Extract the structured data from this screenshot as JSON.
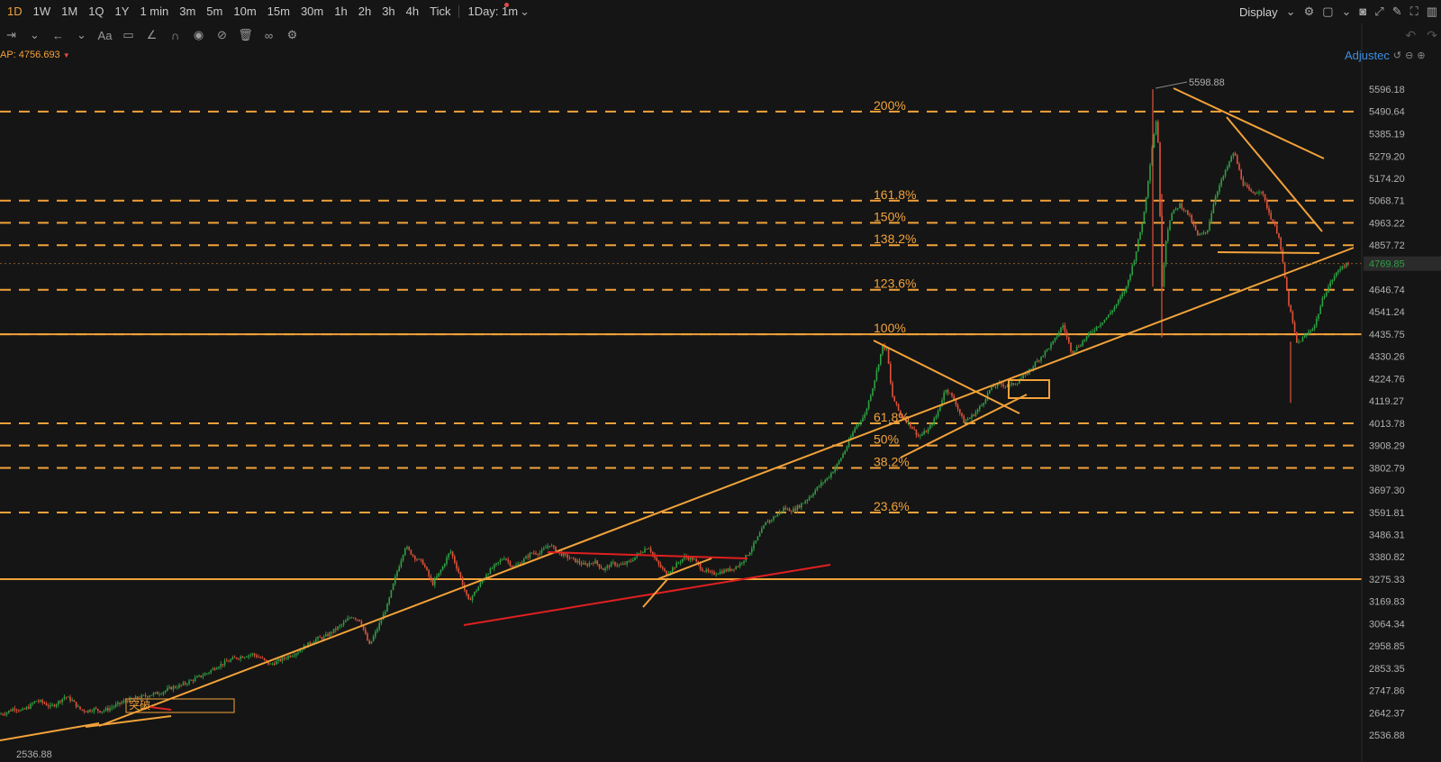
{
  "toolbar": {
    "timeframes": [
      "1D",
      "1W",
      "1M",
      "1Q",
      "1Y",
      "1 min",
      "3m",
      "5m",
      "10m",
      "15m",
      "30m",
      "1h",
      "2h",
      "3h",
      "4h",
      "Tick"
    ],
    "active": "1D",
    "interval_select": "1Day: 1m",
    "display_label": "Display"
  },
  "indicator": {
    "label": "AP:",
    "value": "4756.693"
  },
  "adjust_label": "Adjustec",
  "icons": {
    "toolbar_right": [
      "chevron-down-icon",
      "settings-icon",
      "layout-icon",
      "chevron-down-icon",
      "camera-icon",
      "expand-icon",
      "pencil-icon",
      "fullscreen-icon",
      "panel-icon"
    ],
    "tools": [
      "ruler-icon",
      "arrow-left-icon",
      "text-icon",
      "comment-icon",
      "draw-icon",
      "magnet-icon",
      "eye-icon",
      "hide-icon",
      "trash-icon",
      "link-icon",
      "gear-icon"
    ]
  },
  "colors": {
    "background": "#151515",
    "fib": "#f2a23a",
    "up": "#2ea043",
    "down": "#e0533a",
    "red_line": "#e02020",
    "price_badge": "#2b2b2b"
  },
  "chart_data": {
    "type": "candlestick",
    "y_axis_ticks": [
      5596.18,
      5490.64,
      5385.19,
      5279.2,
      5174.2,
      5068.71,
      4963.22,
      4857.72,
      4646.74,
      4541.24,
      4435.75,
      4330.26,
      4224.76,
      4119.27,
      4013.78,
      3908.29,
      3802.79,
      3697.3,
      3591.81,
      3486.31,
      3380.82,
      3275.33,
      3169.83,
      3064.34,
      2958.85,
      2853.35,
      2747.86,
      2642.37,
      2536.88
    ],
    "current_price": "4769.85",
    "high_label": "5598.88",
    "low_label": "2536.88",
    "ylim": [
      2536.88,
      5596.18
    ],
    "fib_levels": [
      {
        "label": "200%",
        "price": 5490
      },
      {
        "label": "161.8%",
        "price": 5068
      },
      {
        "label": "150%",
        "price": 4963
      },
      {
        "label": "138.2%",
        "price": 4857
      },
      {
        "label": "123.6%",
        "price": 4646
      },
      {
        "label": "100%",
        "price": 4435
      },
      {
        "label": "61.8%",
        "price": 4013
      },
      {
        "label": "50%",
        "price": 3908
      },
      {
        "label": "38.2%",
        "price": 3802
      },
      {
        "label": "23.6%",
        "price": 3591
      }
    ],
    "horizontal_lines": [
      4435,
      3275
    ],
    "annotation_text": "突破",
    "price_path": [
      [
        0,
        2635
      ],
      [
        8,
        2645
      ],
      [
        16,
        2665
      ],
      [
        24,
        2650
      ],
      [
        32,
        2670
      ],
      [
        40,
        2700
      ],
      [
        48,
        2690
      ],
      [
        56,
        2670
      ],
      [
        64,
        2690
      ],
      [
        72,
        2720
      ],
      [
        80,
        2700
      ],
      [
        88,
        2660
      ],
      [
        96,
        2650
      ],
      [
        104,
        2660
      ],
      [
        112,
        2650
      ],
      [
        120,
        2660
      ],
      [
        130,
        2680
      ],
      [
        140,
        2700
      ],
      [
        150,
        2710
      ],
      [
        160,
        2720
      ],
      [
        170,
        2730
      ],
      [
        180,
        2740
      ],
      [
        190,
        2760
      ],
      [
        200,
        2770
      ],
      [
        210,
        2790
      ],
      [
        220,
        2810
      ],
      [
        230,
        2830
      ],
      [
        240,
        2860
      ],
      [
        250,
        2880
      ],
      [
        260,
        2900
      ],
      [
        270,
        2910
      ],
      [
        280,
        2920
      ],
      [
        290,
        2900
      ],
      [
        300,
        2870
      ],
      [
        310,
        2890
      ],
      [
        320,
        2910
      ],
      [
        330,
        2930
      ],
      [
        340,
        2960
      ],
      [
        350,
        2990
      ],
      [
        360,
        3000
      ],
      [
        370,
        3030
      ],
      [
        380,
        3060
      ],
      [
        390,
        3100
      ],
      [
        400,
        3080
      ],
      [
        410,
        2960
      ],
      [
        420,
        3050
      ],
      [
        430,
        3150
      ],
      [
        440,
        3300
      ],
      [
        450,
        3430
      ],
      [
        460,
        3380
      ],
      [
        470,
        3350
      ],
      [
        480,
        3250
      ],
      [
        490,
        3320
      ],
      [
        500,
        3410
      ],
      [
        510,
        3300
      ],
      [
        520,
        3170
      ],
      [
        530,
        3230
      ],
      [
        540,
        3300
      ],
      [
        550,
        3340
      ],
      [
        560,
        3380
      ],
      [
        570,
        3330
      ],
      [
        580,
        3360
      ],
      [
        590,
        3400
      ],
      [
        600,
        3400
      ],
      [
        610,
        3440
      ],
      [
        620,
        3400
      ],
      [
        630,
        3380
      ],
      [
        640,
        3360
      ],
      [
        650,
        3340
      ],
      [
        660,
        3360
      ],
      [
        670,
        3320
      ],
      [
        680,
        3350
      ],
      [
        690,
        3340
      ],
      [
        700,
        3360
      ],
      [
        710,
        3400
      ],
      [
        720,
        3430
      ],
      [
        730,
        3350
      ],
      [
        740,
        3300
      ],
      [
        750,
        3340
      ],
      [
        760,
        3380
      ],
      [
        770,
        3370
      ],
      [
        780,
        3320
      ],
      [
        790,
        3300
      ],
      [
        800,
        3310
      ],
      [
        810,
        3320
      ],
      [
        820,
        3340
      ],
      [
        830,
        3390
      ],
      [
        840,
        3460
      ],
      [
        850,
        3540
      ],
      [
        860,
        3570
      ],
      [
        870,
        3610
      ],
      [
        880,
        3600
      ],
      [
        890,
        3630
      ],
      [
        900,
        3670
      ],
      [
        910,
        3720
      ],
      [
        920,
        3760
      ],
      [
        930,
        3820
      ],
      [
        940,
        3900
      ],
      [
        950,
        4000
      ],
      [
        960,
        4050
      ],
      [
        970,
        4200
      ],
      [
        980,
        4380
      ],
      [
        985,
        4360
      ],
      [
        990,
        4150
      ],
      [
        1000,
        4050
      ],
      [
        1010,
        4010
      ],
      [
        1020,
        3950
      ],
      [
        1030,
        3980
      ],
      [
        1040,
        4050
      ],
      [
        1050,
        4180
      ],
      [
        1060,
        4120
      ],
      [
        1070,
        4020
      ],
      [
        1080,
        4050
      ],
      [
        1090,
        4100
      ],
      [
        1100,
        4180
      ],
      [
        1110,
        4200
      ],
      [
        1120,
        4190
      ],
      [
        1130,
        4210
      ],
      [
        1140,
        4250
      ],
      [
        1150,
        4300
      ],
      [
        1160,
        4350
      ],
      [
        1170,
        4400
      ],
      [
        1180,
        4480
      ],
      [
        1190,
        4350
      ],
      [
        1200,
        4390
      ],
      [
        1210,
        4440
      ],
      [
        1220,
        4480
      ],
      [
        1230,
        4520
      ],
      [
        1240,
        4580
      ],
      [
        1250,
        4650
      ],
      [
        1260,
        4800
      ],
      [
        1270,
        5000
      ],
      [
        1280,
        5350
      ],
      [
        1285,
        5480
      ],
      [
        1290,
        4660
      ],
      [
        1295,
        4900
      ],
      [
        1300,
        5000
      ],
      [
        1310,
        5050
      ],
      [
        1320,
        5000
      ],
      [
        1330,
        4900
      ],
      [
        1340,
        4920
      ],
      [
        1350,
        5100
      ],
      [
        1360,
        5200
      ],
      [
        1370,
        5300
      ],
      [
        1380,
        5150
      ],
      [
        1390,
        5100
      ],
      [
        1400,
        5120
      ],
      [
        1410,
        5000
      ],
      [
        1420,
        4900
      ],
      [
        1430,
        4600
      ],
      [
        1440,
        4390
      ],
      [
        1450,
        4430
      ],
      [
        1460,
        4480
      ],
      [
        1470,
        4620
      ],
      [
        1480,
        4700
      ],
      [
        1490,
        4760
      ],
      [
        1500,
        4769
      ]
    ]
  }
}
